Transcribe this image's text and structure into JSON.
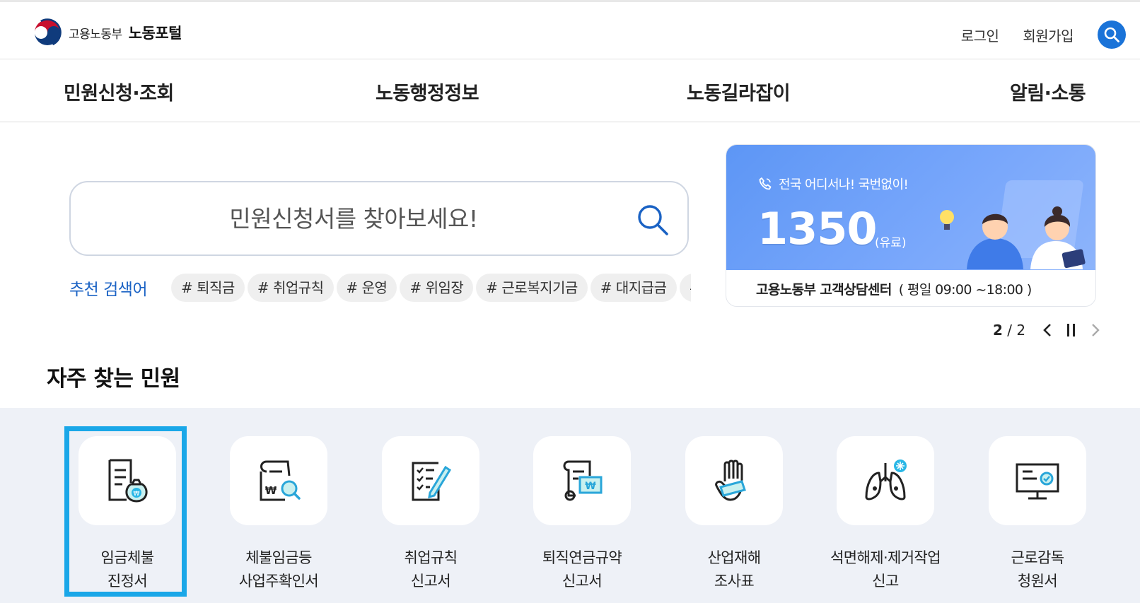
{
  "header": {
    "ministry": "고용노동부",
    "portal": "노동포털",
    "login": "로그인",
    "signup": "회원가입",
    "search_icon": "search-icon"
  },
  "gnb": {
    "items": [
      "민원신청·조회",
      "노동행정정보",
      "노동길라잡이",
      "알림·소통"
    ]
  },
  "search": {
    "placeholder": "민원신청서를 찾아보세요!",
    "recommend_label": "추천 검색어",
    "tags": [
      "# 퇴직금",
      "# 취업규칙",
      "# 운영",
      "# 위임장",
      "# 근로복지기금",
      "# 대지급금",
      "# 고용보험"
    ]
  },
  "banner": {
    "subtitle": "전국 어디서나! 국번없이!",
    "number": "1350",
    "paid": "(유료)",
    "center": "고용노동부 고객상담센터",
    "hours": "( 평일 09:00 ~18:00 )",
    "current": "2",
    "total": "2",
    "accent": "#5d96f5"
  },
  "frequent": {
    "title": "자주 찾는 민원",
    "items": [
      {
        "label": "임금체불\n진정서",
        "icon": "wage-complaint-icon"
      },
      {
        "label": "체불임금등\n사업주확인서",
        "icon": "document-search-icon"
      },
      {
        "label": "취업규칙\n신고서",
        "icon": "checklist-pen-icon"
      },
      {
        "label": "퇴직연금규약\n신고서",
        "icon": "certificate-icon"
      },
      {
        "label": "산업재해\n조사표",
        "icon": "bandaged-hand-icon"
      },
      {
        "label": "석면해제·제거작업\n신고",
        "icon": "lungs-icon"
      },
      {
        "label": "근로감독\n청원서",
        "icon": "monitor-check-icon"
      }
    ]
  }
}
